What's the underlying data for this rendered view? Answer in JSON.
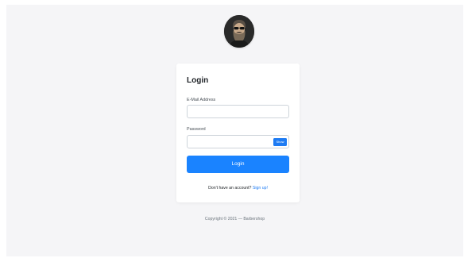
{
  "form": {
    "title": "Login",
    "email_label": "E-Mail Address",
    "email_value": "",
    "password_label": "Password",
    "password_value": "",
    "show_label": "Show",
    "login_label": "Login",
    "signup_prefix": "Don't have an account? ",
    "signup_link": "Sign up!"
  },
  "footer": {
    "copyright": "Copyright © 2021 — Barbershop"
  },
  "colors": {
    "primary": "#1a83ff",
    "background": "#f5f5f7",
    "card": "#ffffff"
  },
  "icons": {
    "logo": "bearded-man-avatar-icon"
  }
}
